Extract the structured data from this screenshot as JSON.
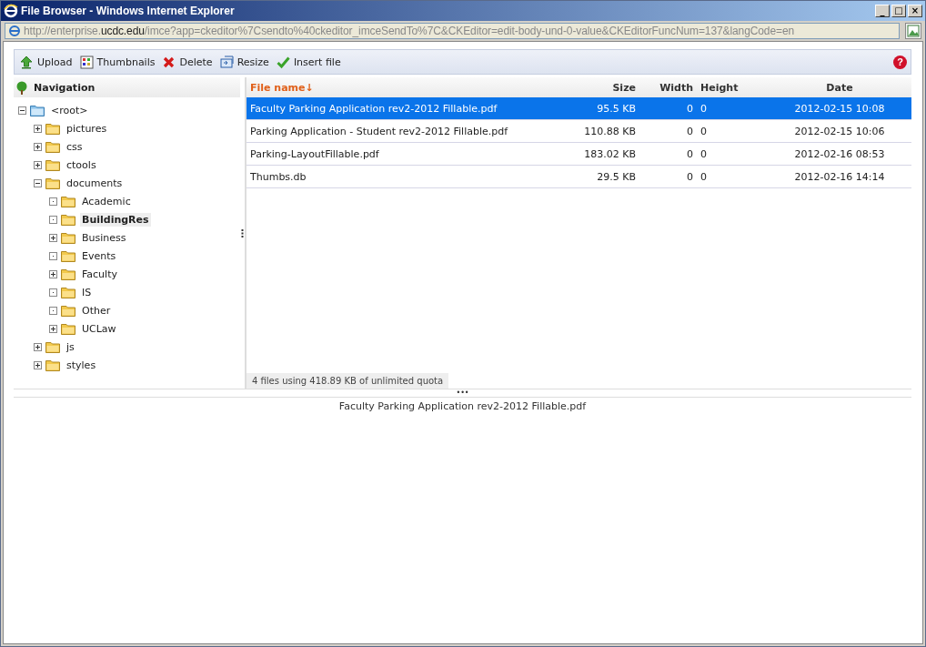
{
  "window": {
    "title": "File Browser - Windows Internet Explorer",
    "controls": [
      "_",
      "□",
      "×"
    ]
  },
  "address": {
    "prefix": "http://enterprise.",
    "domain": "ucdc.edu",
    "path": "/imce?app=ckeditor%7Csendto%40ckeditor_imceSendTo%7C&CKEditor=edit-body-und-0-value&CKEditorFuncNum=137&langCode=en"
  },
  "toolbar": [
    {
      "label": "Upload",
      "kind": "upload"
    },
    {
      "label": "Thumbnails",
      "kind": "thumbnails"
    },
    {
      "label": "Delete",
      "kind": "delete"
    },
    {
      "label": "Resize",
      "kind": "resize"
    },
    {
      "label": "Insert file",
      "kind": "insert"
    }
  ],
  "help": "?",
  "navigation": {
    "title": "Navigation",
    "tree": [
      {
        "label": "<root>",
        "kind": "root",
        "expanded": true,
        "selected": false,
        "children": [
          {
            "label": "pictures",
            "kind": "branch",
            "expanded": false,
            "selected": false
          },
          {
            "label": "css",
            "kind": "branch",
            "expanded": false,
            "selected": false
          },
          {
            "label": "ctools",
            "kind": "branch",
            "expanded": false,
            "selected": false
          },
          {
            "label": "documents",
            "kind": "branch",
            "expanded": true,
            "selected": false,
            "children": [
              {
                "label": "Academic",
                "kind": "leaf",
                "selected": false
              },
              {
                "label": "BuildingRes",
                "kind": "leaf",
                "selected": true
              },
              {
                "label": "Business",
                "kind": "branch",
                "expanded": false,
                "selected": false
              },
              {
                "label": "Events",
                "kind": "leaf",
                "selected": false
              },
              {
                "label": "Faculty",
                "kind": "branch",
                "expanded": false,
                "selected": false
              },
              {
                "label": "IS",
                "kind": "leaf",
                "selected": false
              },
              {
                "label": "Other",
                "kind": "leaf",
                "selected": false
              },
              {
                "label": "UCLaw",
                "kind": "branch",
                "expanded": false,
                "selected": false
              }
            ]
          },
          {
            "label": "js",
            "kind": "branch",
            "expanded": false,
            "selected": false
          },
          {
            "label": "styles",
            "kind": "branch",
            "expanded": false,
            "selected": false
          }
        ]
      }
    ]
  },
  "table": {
    "columns": [
      {
        "label": "File name",
        "sort": "↓",
        "sorted": true
      },
      {
        "label": "Size",
        "sorted": false
      },
      {
        "label": "Width",
        "sorted": false
      },
      {
        "label": "Height",
        "sorted": false
      },
      {
        "label": "Date",
        "sorted": false
      }
    ],
    "rows": [
      {
        "cells": [
          "Faculty Parking Application rev2-2012 Fillable.pdf",
          "95.5 KB",
          "0",
          "0",
          "2012-02-15 10:08"
        ],
        "selected": true
      },
      {
        "cells": [
          "Parking Application - Student rev2-2012 Fillable.pdf",
          "110.88 KB",
          "0",
          "0",
          "2012-02-15 10:06"
        ],
        "selected": false
      },
      {
        "cells": [
          "Parking-LayoutFillable.pdf",
          "183.02 KB",
          "0",
          "0",
          "2012-02-16 08:53"
        ],
        "selected": false
      },
      {
        "cells": [
          "Thumbs.db",
          "29.5 KB",
          "0",
          "0",
          "2012-02-16 14:14"
        ],
        "selected": false
      }
    ]
  },
  "status": "4 files using 418.89 KB of unlimited quota",
  "splitter": "•••",
  "preview": "Faculty Parking Application rev2-2012 Fillable.pdf"
}
